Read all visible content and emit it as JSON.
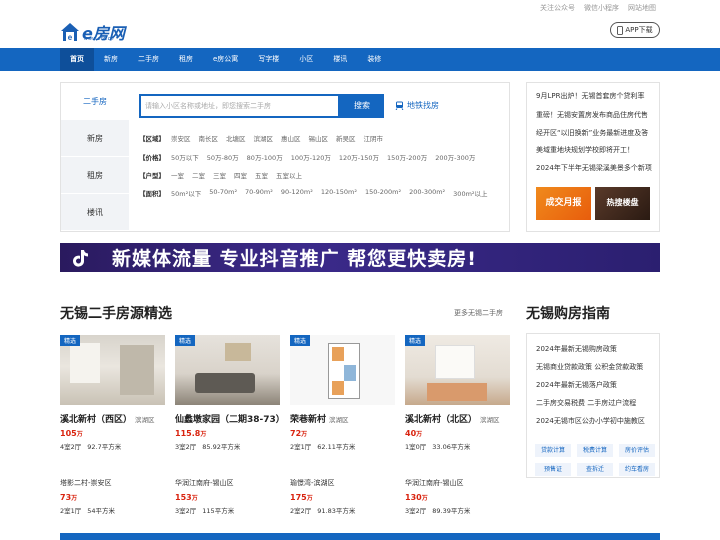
{
  "topbar": {
    "links": [
      "关注公众号",
      "微信小程序",
      "网站地图"
    ]
  },
  "logo": {
    "name": "e房网",
    "url": "www.efw.cn"
  },
  "app_button": "APP下载",
  "nav": {
    "items": [
      "首页",
      "新房",
      "二手房",
      "租房",
      "e房公寓",
      "写字楼",
      "小区",
      "楼讯",
      "装修"
    ]
  },
  "search": {
    "tabs": [
      "二手房",
      "新房",
      "租房",
      "楼讯"
    ],
    "placeholder": "请输入小区名称或地址，即您搜索二手房",
    "button": "搜索",
    "subway": "地铁找房",
    "filters": [
      {
        "label": "【区域】",
        "options": [
          "崇安区",
          "南长区",
          "北塘区",
          "滨湖区",
          "惠山区",
          "锡山区",
          "新吴区",
          "江阴市"
        ]
      },
      {
        "label": "【价格】",
        "options": [
          "50万以下",
          "50万-80万",
          "80万-100万",
          "100万-120万",
          "120万-150万",
          "150万-200万",
          "200万-300万"
        ]
      },
      {
        "label": "【户型】",
        "options": [
          "一室",
          "二室",
          "三室",
          "四室",
          "五室",
          "五室以上"
        ]
      },
      {
        "label": "【面积】",
        "options": [
          "50m²以下",
          "50-70m²",
          "70-90m²",
          "90-120m²",
          "120-150m²",
          "150-200m²",
          "200-300m²",
          "300m²以上"
        ]
      }
    ]
  },
  "news": {
    "lines": [
      "9月LPR出炉！无锡首套房个贷利率",
      "重磅！无锡安置房发布商品住房代售",
      "经开区“以旧换新”业务最新进度及答",
      "美域重地块规划学校即将开工！",
      "2024年下半年无锡梁溪美景多个新项"
    ],
    "promo1": "成交月报",
    "promo2": "热搜楼盘"
  },
  "banner": {
    "text": "新媒体流量 专业抖音推广 帮您更快卖房!"
  },
  "listings": {
    "title": "无锡二手房源精选",
    "more": "更多无锡二手房",
    "featured": [
      {
        "badge": "精选",
        "name": "溪北新村（西区）",
        "district": "滨湖区",
        "price": "105",
        "unit": "万",
        "rooms": "4室2厅",
        "area": "92.7平方米"
      },
      {
        "badge": "精选",
        "name": "仙蠡墩家园（二期38-73）",
        "district": "滨湖区",
        "price": "115.8",
        "unit": "万",
        "rooms": "3室2厅",
        "area": "85.92平方米"
      },
      {
        "badge": "精选",
        "name": "荣巷新村",
        "district": "滨湖区",
        "price": "72",
        "unit": "万",
        "rooms": "2室1厅",
        "area": "62.11平方米"
      },
      {
        "badge": "精选",
        "name": "溪北新村（北区）",
        "district": "滨湖区",
        "price": "40",
        "unit": "万",
        "rooms": "1室0厅",
        "area": "33.06平方米"
      }
    ],
    "compact": [
      {
        "name": "塔影二村-崇安区",
        "price": "73",
        "unit": "万",
        "rooms": "2室1厅",
        "area": "54平方米"
      },
      {
        "name": "华润江南府-锡山区",
        "price": "153",
        "unit": "万",
        "rooms": "3室2厅",
        "area": "115平方米"
      },
      {
        "name": "瑜憬湾-滨湖区",
        "price": "175",
        "unit": "万",
        "rooms": "2室2厅",
        "area": "91.83平方米"
      },
      {
        "name": "华润江南府-锡山区",
        "price": "130",
        "unit": "万",
        "rooms": "3室2厅",
        "area": "89.39平方米"
      }
    ]
  },
  "guide": {
    "title": "无锡购房指南",
    "items": [
      "2024年最新无锡购房政策",
      "无锡商业贷款政策 公积金贷款政策",
      "2024年最新无锡落户政策",
      "二手房交易税费 二手房过户流程",
      "2024无锡市区公办小学初中施教区"
    ],
    "calcs": [
      "贷款计算",
      "税费计算",
      "房价评估",
      "预售证",
      "查拆迁",
      "约车看房"
    ]
  },
  "colors": {
    "brand": "#1466c0",
    "price": "#d9230f"
  }
}
